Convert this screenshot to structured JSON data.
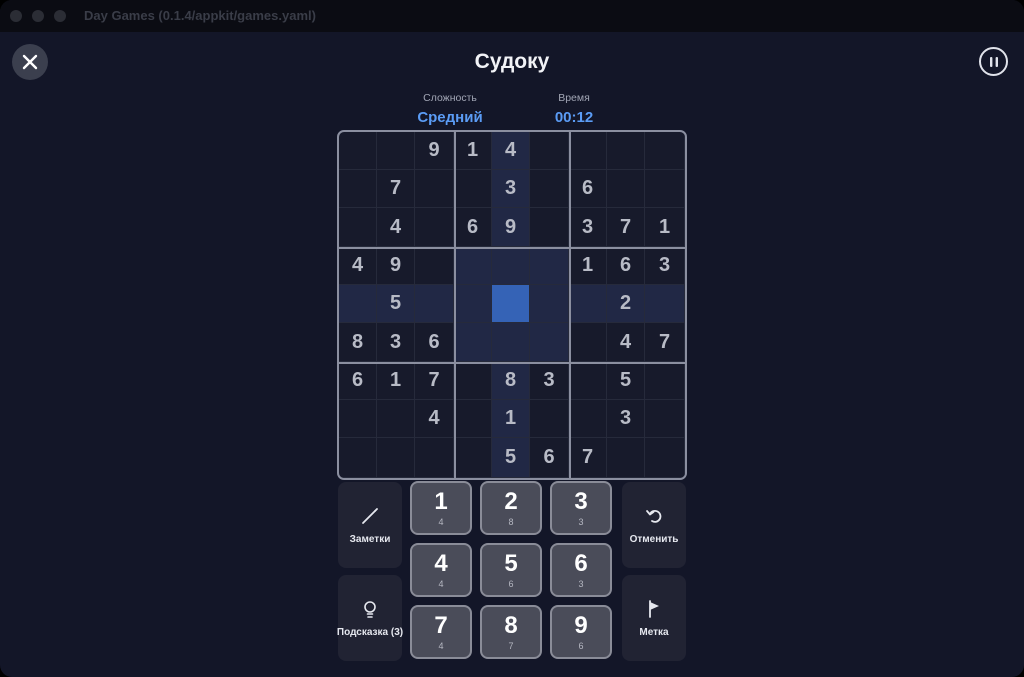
{
  "window": {
    "title": "Day Games (0.1.4/appkit/games.yaml)"
  },
  "header": {
    "title": "Судоку"
  },
  "info": {
    "difficulty_label": "Сложность",
    "difficulty_value": "Средний",
    "time_label": "Время",
    "time_value": "00:12"
  },
  "colors": {
    "accent": "#5b9cf5",
    "selected": "#3563b6",
    "highlight": "#212845"
  },
  "board": {
    "selected": {
      "row": 4,
      "col": 4
    },
    "grid": [
      [
        "",
        "",
        "9",
        "1",
        "4",
        "",
        "",
        "",
        ""
      ],
      [
        "",
        "7",
        "",
        "",
        "3",
        "",
        "6",
        "",
        ""
      ],
      [
        "",
        "4",
        "",
        "6",
        "9",
        "",
        "3",
        "7",
        "1"
      ],
      [
        "4",
        "9",
        "",
        "",
        "",
        "",
        "1",
        "6",
        "3"
      ],
      [
        "",
        "5",
        "",
        "",
        "",
        "",
        "",
        "2",
        ""
      ],
      [
        "8",
        "3",
        "6",
        "",
        "",
        "",
        "",
        "4",
        "7"
      ],
      [
        "6",
        "1",
        "7",
        "",
        "8",
        "3",
        "",
        "5",
        ""
      ],
      [
        "",
        "",
        "4",
        "",
        "1",
        "",
        "",
        "3",
        ""
      ],
      [
        "",
        "",
        "",
        "",
        "5",
        "6",
        "7",
        "",
        ""
      ]
    ]
  },
  "controls": {
    "notes_label": "Заметки",
    "hint_label": "Подсказка (3)",
    "undo_label": "Отменить",
    "mark_label": "Метка"
  },
  "numpad": [
    {
      "digit": "1",
      "count": "4"
    },
    {
      "digit": "2",
      "count": "8"
    },
    {
      "digit": "3",
      "count": "3"
    },
    {
      "digit": "4",
      "count": "4"
    },
    {
      "digit": "5",
      "count": "6"
    },
    {
      "digit": "6",
      "count": "3"
    },
    {
      "digit": "7",
      "count": "4"
    },
    {
      "digit": "8",
      "count": "7"
    },
    {
      "digit": "9",
      "count": "6"
    }
  ],
  "icons": {
    "close": "close-icon",
    "pause": "pause-icon",
    "notes": "pencil-icon",
    "hint": "lightbulb-icon",
    "undo": "undo-icon",
    "mark": "flag-icon"
  }
}
